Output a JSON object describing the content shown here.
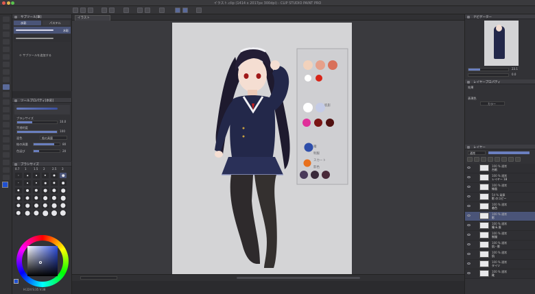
{
  "app": {
    "title": "イラスト.clip (1414 x 2017px 300dpi) - CLIP STUDIO PAINT PRO"
  },
  "document_tab": {
    "label": "イラスト"
  },
  "subtool_panel": {
    "title": "サブツール[筆]",
    "tabs": [
      "水彩",
      "パステル"
    ],
    "selected_brush_label": "水彩",
    "add_button_label": "サブツールを追加する"
  },
  "tool_property": {
    "title": "ツールプロパティ[水彩]",
    "rows": [
      {
        "label": "ブラシサイズ",
        "value": "10.0"
      },
      {
        "label": "不透明度",
        "value": "100"
      },
      {
        "label": "混色",
        "value": "絵の具量"
      },
      {
        "label": "絵の具量",
        "value": "80"
      },
      {
        "label": "色延び",
        "value": "20"
      }
    ]
  },
  "brush_size_panel": {
    "title": "ブラシサイズ",
    "sizes": [
      "0.7",
      "1",
      "1.5",
      "2",
      "2.5",
      "3"
    ]
  },
  "color_panel": {
    "readout": "H:224 S:35 V:38"
  },
  "navigator": {
    "title": "ナビゲーター",
    "zoom": "23.1",
    "angle": "0.0"
  },
  "layer_property": {
    "title": "レイヤープロパティ",
    "effect_label": "効果",
    "color_label": "表現色",
    "color_value": "カラー"
  },
  "layer_panel": {
    "title": "レイヤー",
    "blend_mode": "通常",
    "layers": [
      {
        "top": "100 % 通常",
        "name": "台紙",
        "selected": false
      },
      {
        "top": "100 % 通常",
        "name": "レイヤー 18",
        "selected": false
      },
      {
        "top": "100 % 通常",
        "name": "線画",
        "selected": false
      },
      {
        "top": "54 % 乗算",
        "name": "影 のコピー",
        "selected": false
      },
      {
        "top": "100 % 通常",
        "name": "着色",
        "selected": false
      },
      {
        "top": "100 % 通常",
        "name": "影",
        "selected": true
      },
      {
        "top": "100 % 通常",
        "name": "瞳 & 眉",
        "selected": false
      },
      {
        "top": "100 % 通常",
        "name": "制服",
        "selected": false
      },
      {
        "top": "100 % 通常",
        "name": "肌・影",
        "selected": false
      },
      {
        "top": "100 % 通常",
        "name": "肌",
        "selected": false
      },
      {
        "top": "100 % 通常",
        "name": "タイツ",
        "selected": false
      },
      {
        "top": "100 % 通常",
        "name": "靴",
        "selected": false
      }
    ]
  },
  "palette_notes": {
    "note1": "肌影",
    "note2": "瞳",
    "note3": "制服",
    "note4": "スカート",
    "note5": "影色"
  },
  "colors": {
    "accent": "#5a6a9a",
    "selection": "#4a5478",
    "paper": "#d4d4d6",
    "uniform": "#23284a",
    "tights": "#2e2a2c",
    "hair": "#1e1a2e",
    "skin": "#f5ded2",
    "swatches_row1": [
      "#f2d2bc",
      "#e6a08a",
      "#d8705a"
    ],
    "swatches_row2": [
      "#ffffff",
      "#d82418"
    ],
    "swatches_row3": [
      "#ffffff",
      "#c4cbe6"
    ],
    "swatches_row4": [
      "#e0309a",
      "#7a1414",
      "#501010"
    ],
    "swatches_row5": [
      "#2e4eaa"
    ],
    "swatches_row6": [
      "#e8701c"
    ],
    "swatches_row7": [
      "#4a3a5a",
      "#3a2a3a",
      "#4a2a3a"
    ]
  },
  "icons": [
    "pen-icon",
    "eraser-icon",
    "fill-icon",
    "text-icon",
    "move-icon",
    "eye-icon",
    "gear-icon",
    "folder-icon"
  ]
}
